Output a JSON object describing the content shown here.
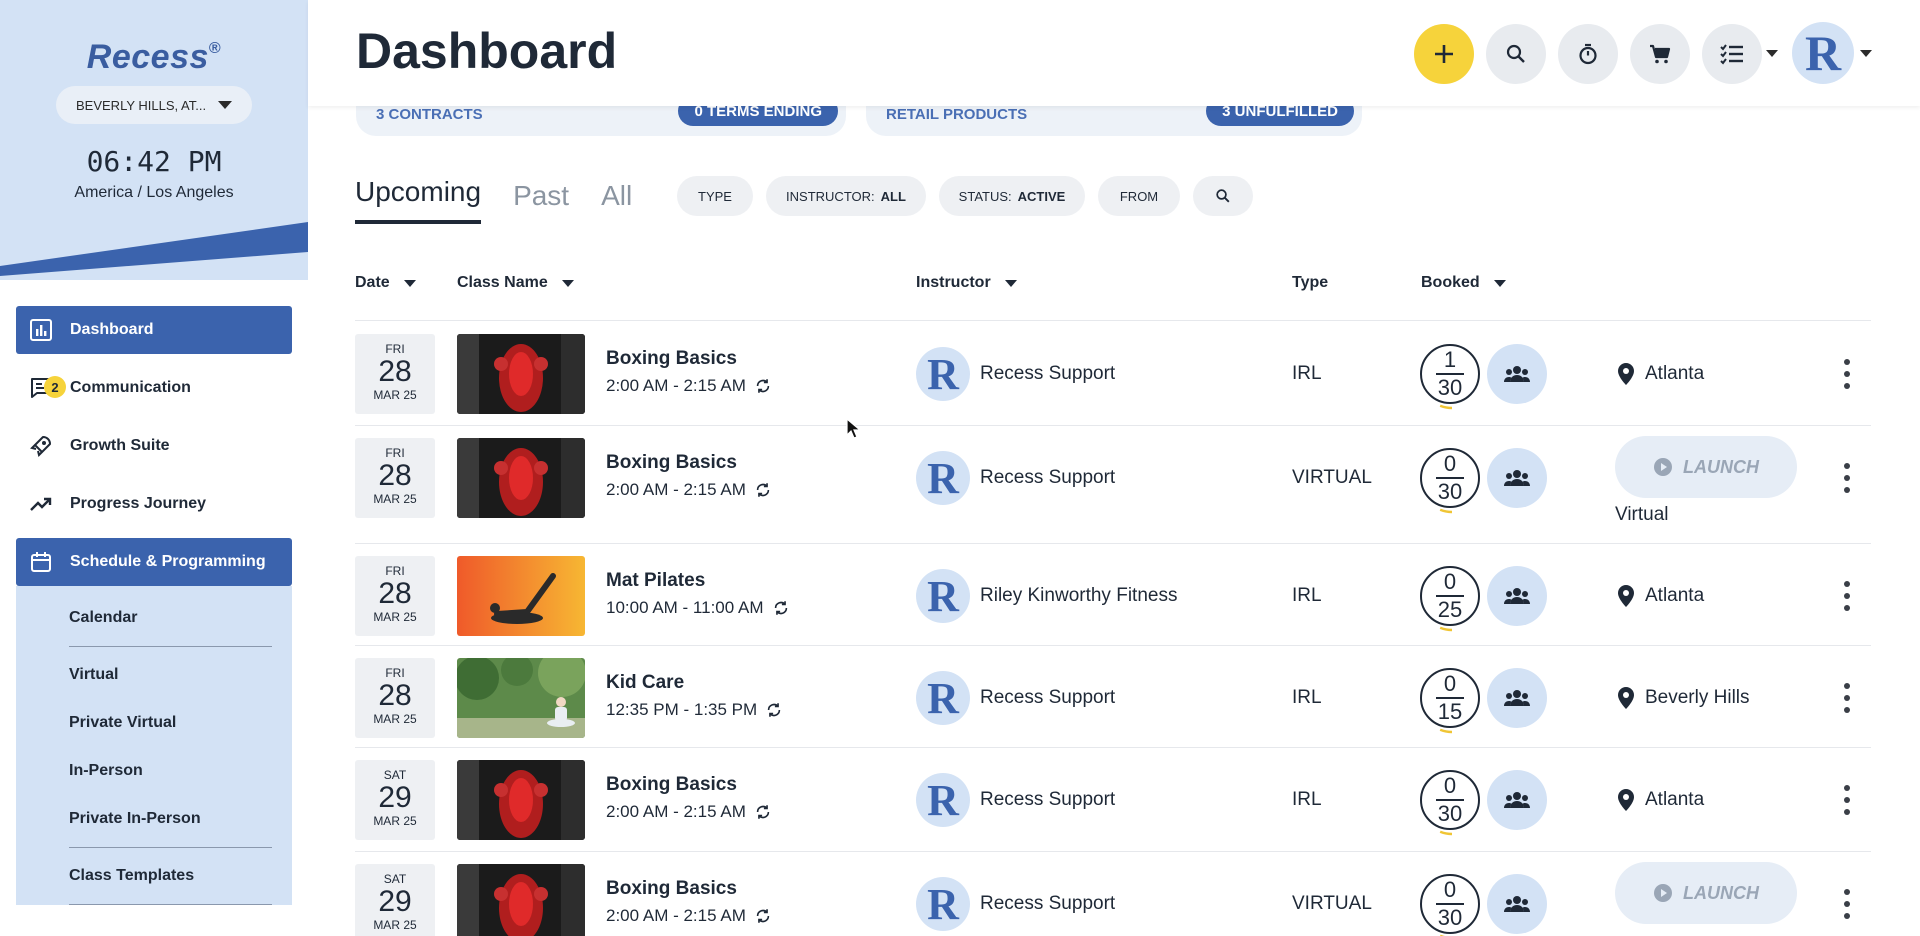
{
  "sidebar": {
    "logo": "Recess",
    "logo_mark": "®",
    "location": "BEVERLY HILLS, AT...",
    "clock": "06:42 PM",
    "timezone": "America / Los Angeles",
    "items": [
      {
        "label": "Dashboard",
        "icon": "chart-icon",
        "active": true
      },
      {
        "label": "Communication",
        "icon": "chat-icon",
        "badge": "2"
      },
      {
        "label": "Growth Suite",
        "icon": "rocket-icon"
      },
      {
        "label": "Progress Journey",
        "icon": "trend-icon"
      },
      {
        "label": "Schedule & Programming",
        "icon": "calendar-icon",
        "active": true
      }
    ],
    "subitems": [
      "Calendar",
      "Virtual",
      "Private Virtual",
      "In-Person",
      "Private In-Person",
      "Class Templates"
    ]
  },
  "header": {
    "title": "Dashboard",
    "buttons": [
      "add-icon",
      "search-icon",
      "stopwatch-icon",
      "cart-icon",
      "checklist-icon"
    ],
    "avatar_letter": "R"
  },
  "stats": {
    "contracts": "3 CONTRACTS",
    "terms": "0 TERMS ENDING",
    "retail": "RETAIL PRODUCTS",
    "unfulfilled": "3 UNFULFILLED"
  },
  "tabs": [
    "Upcoming",
    "Past",
    "All"
  ],
  "filters": {
    "type": "TYPE",
    "instructor_label": "INSTRUCTOR:",
    "instructor_value": "ALL",
    "status_label": "STATUS:",
    "status_value": "ACTIVE",
    "from": "FROM"
  },
  "columns": {
    "date": "Date",
    "class_name": "Class Name",
    "instructor": "Instructor",
    "type": "Type",
    "booked": "Booked"
  },
  "rows": [
    {
      "dow": "FRI",
      "day": "28",
      "mon": "MAR 25",
      "name": "Boxing Basics",
      "time": "2:00 AM - 2:15 AM",
      "instructor": "Recess Support",
      "type": "IRL",
      "booked": "1",
      "capacity": "30",
      "location": "Atlanta",
      "thumb": "boxing"
    },
    {
      "dow": "FRI",
      "day": "28",
      "mon": "MAR 25",
      "name": "Boxing Basics",
      "time": "2:00 AM - 2:15 AM",
      "instructor": "Recess Support",
      "type": "VIRTUAL",
      "booked": "0",
      "capacity": "30",
      "launch": "LAUNCH",
      "launch_sub": "Virtual",
      "thumb": "boxing"
    },
    {
      "dow": "FRI",
      "day": "28",
      "mon": "MAR 25",
      "name": "Mat Pilates",
      "time": "10:00 AM - 11:00 AM",
      "instructor": "Riley Kinworthy Fitness",
      "type": "IRL",
      "booked": "0",
      "capacity": "25",
      "location": "Atlanta",
      "thumb": "pilates"
    },
    {
      "dow": "FRI",
      "day": "28",
      "mon": "MAR 25",
      "name": "Kid Care",
      "time": "12:35 PM - 1:35 PM",
      "instructor": "Recess Support",
      "type": "IRL",
      "booked": "0",
      "capacity": "15",
      "location": "Beverly Hills",
      "thumb": "yoga"
    },
    {
      "dow": "SAT",
      "day": "29",
      "mon": "MAR 25",
      "name": "Boxing Basics",
      "time": "2:00 AM - 2:15 AM",
      "instructor": "Recess Support",
      "type": "IRL",
      "booked": "0",
      "capacity": "30",
      "location": "Atlanta",
      "thumb": "boxing"
    },
    {
      "dow": "SAT",
      "day": "29",
      "mon": "MAR 25",
      "name": "Boxing Basics",
      "time": "2:00 AM - 2:15 AM",
      "instructor": "Recess Support",
      "type": "VIRTUAL",
      "booked": "0",
      "capacity": "30",
      "launch": "LAUNCH",
      "thumb": "boxing"
    }
  ]
}
